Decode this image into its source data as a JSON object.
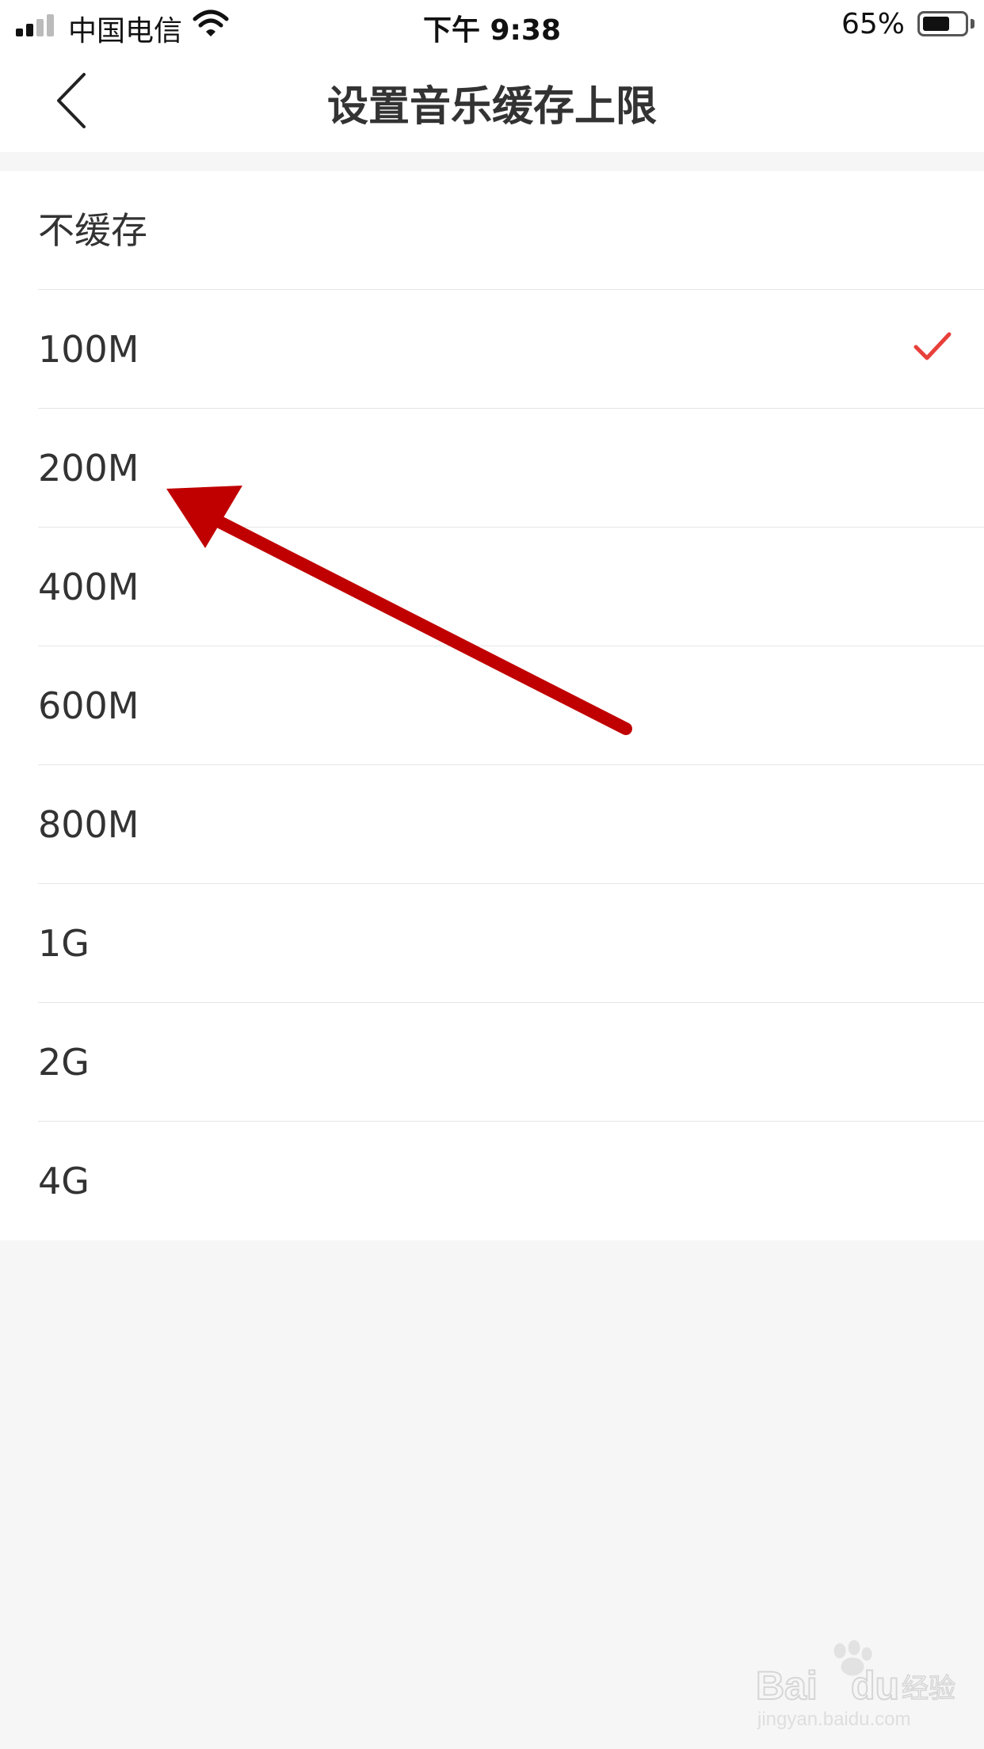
{
  "status_bar": {
    "carrier": "中国电信",
    "time": "下午 9:38",
    "battery_percent": "65%",
    "battery_level": 0.65,
    "signal_bars_filled": 2
  },
  "nav": {
    "title": "设置音乐缓存上限",
    "back_icon": "chevron-left-icon"
  },
  "options": [
    {
      "label": "不缓存",
      "selected": false
    },
    {
      "label": "100M",
      "selected": true
    },
    {
      "label": "200M",
      "selected": false
    },
    {
      "label": "400M",
      "selected": false
    },
    {
      "label": "600M",
      "selected": false
    },
    {
      "label": "800M",
      "selected": false
    },
    {
      "label": "1G",
      "selected": false
    },
    {
      "label": "2G",
      "selected": false
    },
    {
      "label": "4G",
      "selected": false
    }
  ],
  "colors": {
    "accent": "#e8403a",
    "annotation_arrow": "#c00000",
    "background": "#f6f6f6"
  },
  "watermark": {
    "brand": "Baidu经验",
    "url": "jingyan.baidu.com"
  }
}
